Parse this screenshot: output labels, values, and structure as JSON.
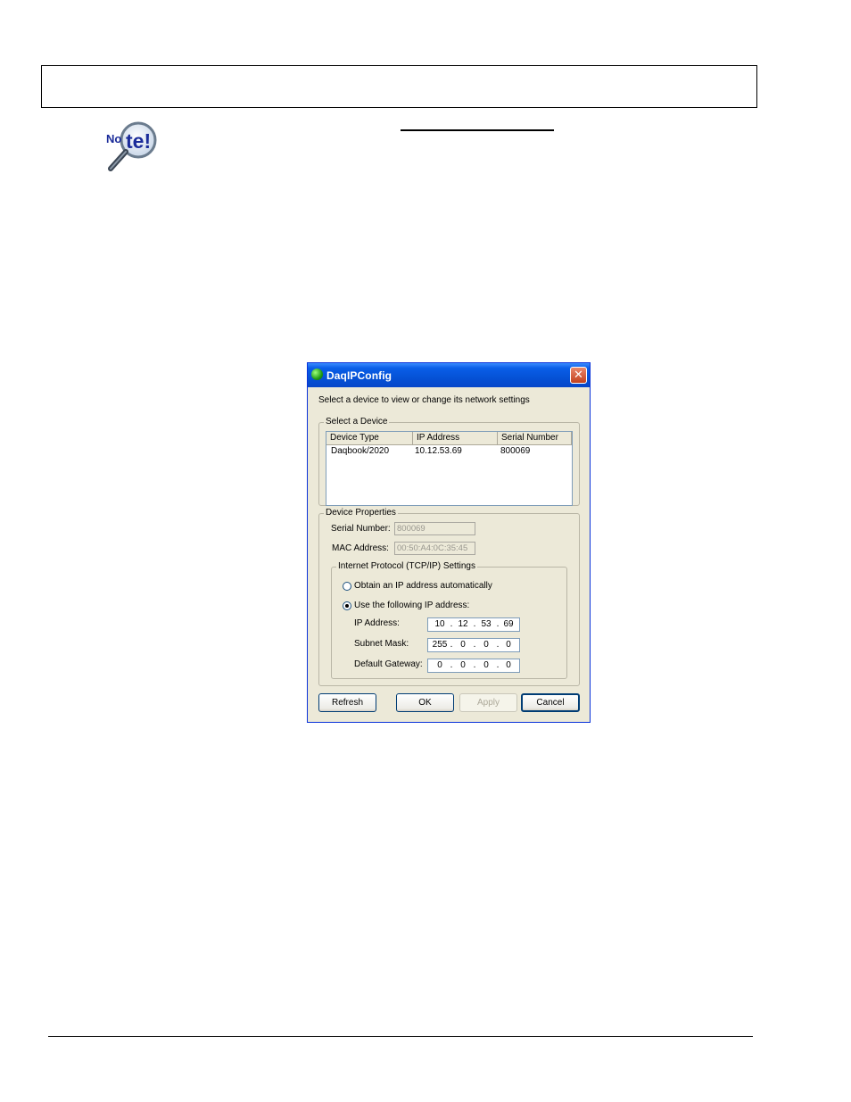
{
  "dialog": {
    "title": "DaqIPConfig",
    "close_glyph": "✕",
    "instruction": "Select a device to view or change its network settings",
    "select_group_label": "Select a Device",
    "columns": [
      "Device Type",
      "IP Address",
      "Serial Number"
    ],
    "rows": [
      {
        "device_type": "Daqbook/2020",
        "ip_address": "10.12.53.69",
        "serial_number": "800069"
      }
    ],
    "properties_group_label": "Device Properties",
    "serial_number_label": "Serial Number:",
    "serial_number_value": "800069",
    "mac_address_label": "MAC Address:",
    "mac_address_value": "00:50:A4:0C:35:45",
    "tcpip_group_label": "Internet Protocol (TCP/IP) Settings",
    "radio_auto_label": "Obtain an IP address automatically",
    "radio_manual_label": "Use the following IP address:",
    "selected_radio": "manual",
    "ip_label": "IP Address:",
    "ip_octets": [
      "10",
      "12",
      "53",
      "69"
    ],
    "subnet_label": "Subnet Mask:",
    "subnet_octets": [
      "255",
      "0",
      "0",
      "0"
    ],
    "gateway_label": "Default Gateway:",
    "gateway_octets": [
      "0",
      "0",
      "0",
      "0"
    ],
    "buttons": {
      "refresh": "Refresh",
      "ok": "OK",
      "apply": "Apply",
      "cancel": "Cancel"
    }
  },
  "note_icon": {
    "text": "Note!",
    "icon": "magnifier-icon"
  },
  "colors": {
    "titlebar": "#0552d6",
    "dialog_bg": "#ece9d8",
    "close_button": "#c3411e"
  }
}
